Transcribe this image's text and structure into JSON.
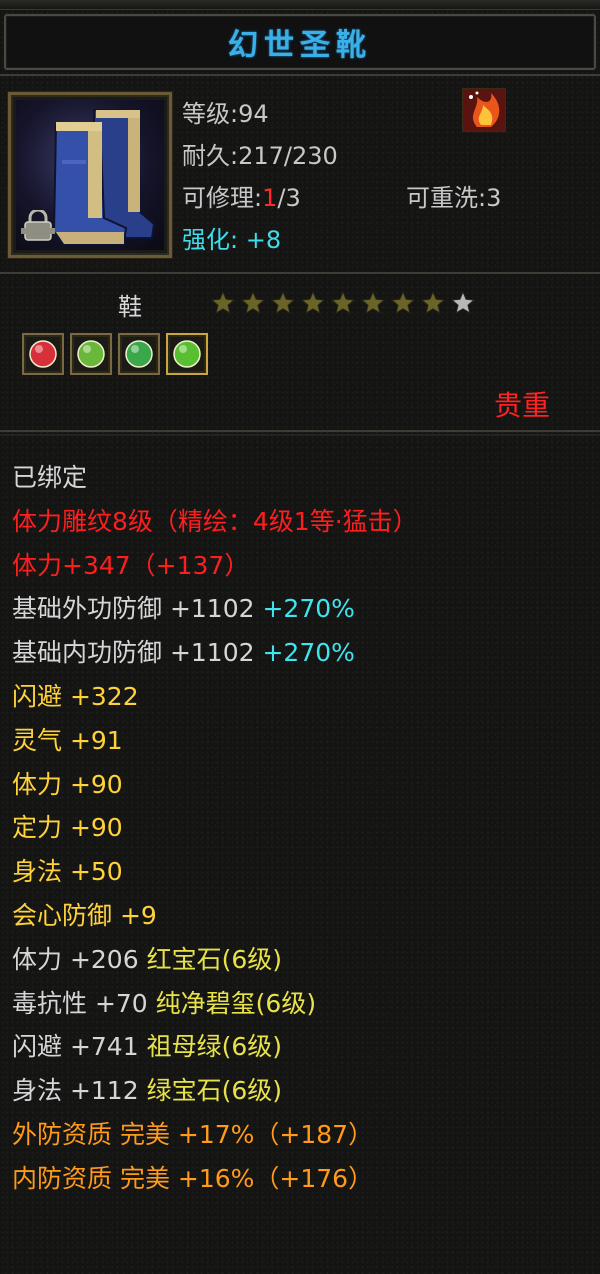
{
  "item": {
    "name": "幻世圣靴",
    "level_label": "等级",
    "level_value": ":94",
    "durability_label": "耐久",
    "durability_value": ":217/230",
    "repair_label": "可修理:",
    "repair_used": "1",
    "repair_total": "/3",
    "rewash_label": "可重洗",
    "rewash_value": ":3",
    "enhance_label": "强化:",
    "enhance_value": "+8",
    "slot_type": "鞋",
    "stars_filled": 8,
    "stars_total": 9,
    "rarity": "贵重",
    "icon": "boots-icon"
  },
  "sockets": [
    {
      "icon": "red-gem-socket-icon",
      "color": "#d8303a"
    },
    {
      "icon": "jade-socket-icon",
      "color": "#6ab83a"
    },
    {
      "icon": "emerald-socket-icon",
      "color": "#3aa84a"
    },
    {
      "icon": "green-gem-socket-icon",
      "color": "#58c030"
    }
  ],
  "attributes": [
    {
      "parts": [
        {
          "text": "已绑定",
          "class": "c-white"
        }
      ]
    },
    {
      "parts": [
        {
          "text": "体力雕纹8级（精绘：4级1等·猛击）",
          "class": "c-red"
        }
      ]
    },
    {
      "parts": [
        {
          "text": "体力+347（+137）",
          "class": "c-red"
        }
      ]
    },
    {
      "parts": [
        {
          "text": "基础外功防御 +1102 ",
          "class": "c-white"
        },
        {
          "text": "+270%",
          "class": "c-cyan"
        }
      ]
    },
    {
      "parts": [
        {
          "text": "基础内功防御 +1102 ",
          "class": "c-white"
        },
        {
          "text": "+270%",
          "class": "c-cyan"
        }
      ]
    },
    {
      "parts": [
        {
          "text": "闪避 +322",
          "class": "c-yellow"
        }
      ]
    },
    {
      "parts": [
        {
          "text": "灵气 +91",
          "class": "c-yellow"
        }
      ]
    },
    {
      "parts": [
        {
          "text": "体力 +90",
          "class": "c-yellow"
        }
      ]
    },
    {
      "parts": [
        {
          "text": "定力 +90",
          "class": "c-yellow"
        }
      ]
    },
    {
      "parts": [
        {
          "text": "身法 +50",
          "class": "c-yellow"
        }
      ]
    },
    {
      "parts": [
        {
          "text": "会心防御 +9",
          "class": "c-yellow"
        }
      ]
    },
    {
      "parts": [
        {
          "text": "体力 +206 ",
          "class": "c-white"
        },
        {
          "text": "红宝石(6级)",
          "class": "c-gem"
        }
      ]
    },
    {
      "parts": [
        {
          "text": "毒抗性 +70 ",
          "class": "c-white"
        },
        {
          "text": "纯净碧玺(6级)",
          "class": "c-gem"
        }
      ]
    },
    {
      "parts": [
        {
          "text": "闪避 +741 ",
          "class": "c-white"
        },
        {
          "text": "祖母绿(6级)",
          "class": "c-gem"
        }
      ]
    },
    {
      "parts": [
        {
          "text": "身法 +112 ",
          "class": "c-white"
        },
        {
          "text": "绿宝石(6级)",
          "class": "c-gem"
        }
      ]
    },
    {
      "parts": [
        {
          "text": "外防资质  完美 +17%（+187）",
          "class": "c-orange"
        }
      ]
    },
    {
      "parts": [
        {
          "text": "内防资质  完美 +16%（+176）",
          "class": "c-orange"
        }
      ]
    }
  ],
  "colors": {
    "title": "#3bb0e6",
    "rarity": "#ff2222",
    "enhance": "#3fdcec",
    "star_filled": "#6b6428",
    "star_empty": "#b8b8b8"
  }
}
